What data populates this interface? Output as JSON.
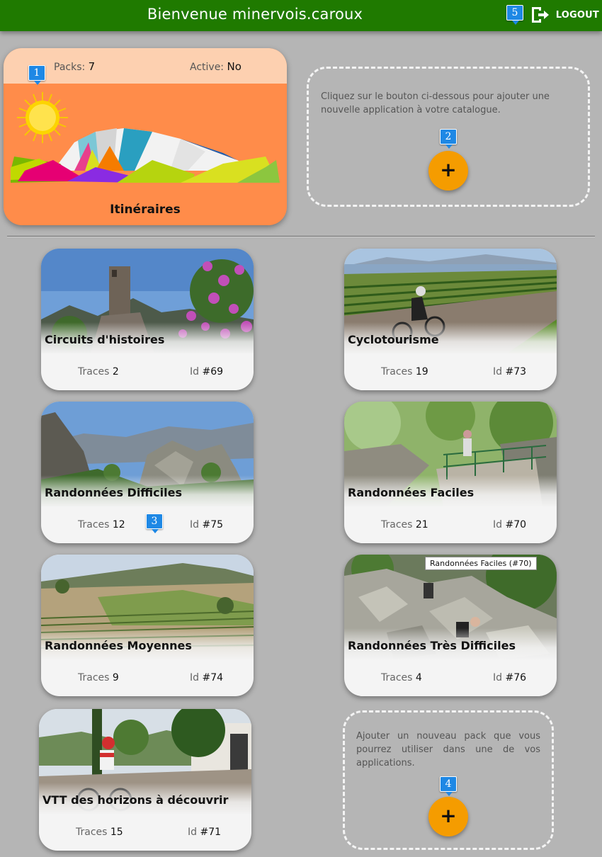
{
  "header": {
    "title": "Bienvenue minervois.caroux",
    "logout_label": "LOGOUT"
  },
  "markers": [
    "1",
    "2",
    "3",
    "4",
    "5"
  ],
  "app": {
    "packs_label": "Packs:",
    "packs_value": "7",
    "active_label": "Active:",
    "active_value": "No",
    "name": "Itinéraires"
  },
  "add_app": {
    "text": "Cliquez sur le bouton ci-dessous pour ajouter une nouvelle application à votre catalogue.",
    "button": "+"
  },
  "add_pack": {
    "text": "Ajouter un nouveau pack que vous pourrez utiliser dans une de vos applications.",
    "button": "+"
  },
  "packs": [
    {
      "name": "Circuits d'histoires",
      "traces_label": "Traces",
      "traces": "2",
      "id_label": "Id",
      "id": "#69"
    },
    {
      "name": "Cyclotourisme",
      "traces_label": "Traces",
      "traces": "19",
      "id_label": "Id",
      "id": "#73"
    },
    {
      "name": "Randonnées Difficiles",
      "traces_label": "Traces",
      "traces": "12",
      "id_label": "Id",
      "id": "#75"
    },
    {
      "name": "Randonnées Faciles",
      "traces_label": "Traces",
      "traces": "21",
      "id_label": "Id",
      "id": "#70"
    },
    {
      "name": "Randonnées Moyennes",
      "traces_label": "Traces",
      "traces": "9",
      "id_label": "Id",
      "id": "#74"
    },
    {
      "name": "Randonnées Très Difficiles",
      "traces_label": "Traces",
      "traces": "4",
      "id_label": "Id",
      "id": "#76"
    },
    {
      "name": "VTT des horizons à découvrir",
      "traces_label": "Traces",
      "traces": "15",
      "id_label": "Id",
      "id": "#71"
    }
  ],
  "tooltip": "Randonnées Faciles (#70)",
  "colors": {
    "topbar": "#1f7a00",
    "marker": "#1e88e5",
    "app_card": "#ff8c4a",
    "add_button": "#f59c00"
  }
}
